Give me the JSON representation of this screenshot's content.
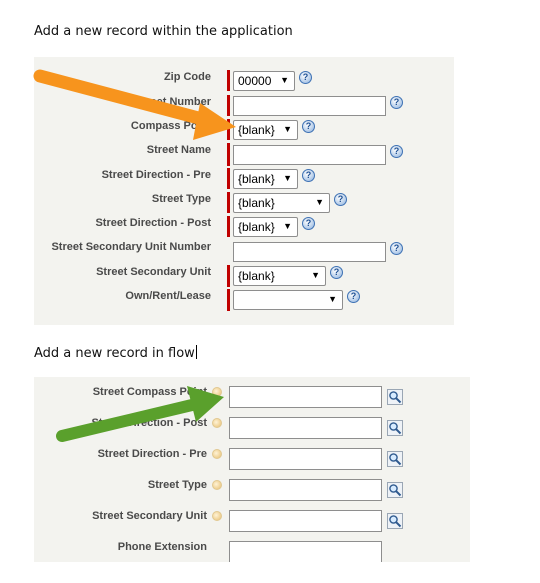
{
  "heading_top": "Add a new record within the application",
  "heading_bottom": "Add a new record in flow",
  "app_form": {
    "fields": [
      {
        "label": "Zip Code",
        "value": "00000",
        "help": "?"
      },
      {
        "label": "Street Number",
        "value": "",
        "help": "?"
      },
      {
        "label": "Compass Point",
        "value": "{blank}",
        "help": "?"
      },
      {
        "label": "Street Name",
        "value": "",
        "help": "?"
      },
      {
        "label": "Street Direction - Pre",
        "value": "{blank}",
        "help": "?"
      },
      {
        "label": "Street Type",
        "value": "{blank}",
        "help": "?"
      },
      {
        "label": "Street Direction - Post",
        "value": "{blank}",
        "help": "?"
      },
      {
        "label": "Street Secondary Unit Number",
        "value": "",
        "help": "?"
      },
      {
        "label": "Street Secondary Unit",
        "value": "{blank}",
        "help": "?"
      },
      {
        "label": "Own/Rent/Lease",
        "value": "",
        "help": "?"
      }
    ]
  },
  "flow_form": {
    "fields": [
      {
        "label": "Street Compass Point",
        "value": ""
      },
      {
        "label": "Street Direction - Post",
        "value": ""
      },
      {
        "label": "Street Direction - Pre",
        "value": ""
      },
      {
        "label": "Street Type",
        "value": ""
      },
      {
        "label": "Street Secondary Unit",
        "value": ""
      },
      {
        "label": "Phone Extension",
        "value": ""
      }
    ]
  },
  "colors": {
    "required_bar": "#c00000",
    "orange_arrow": "#f7941d",
    "green_arrow": "#5aa02c",
    "panel": "#f3f3ef"
  },
  "icons": {
    "help": "question-circle-icon",
    "lookup": "magnifier-icon",
    "info_dot": "info-dot-icon"
  }
}
